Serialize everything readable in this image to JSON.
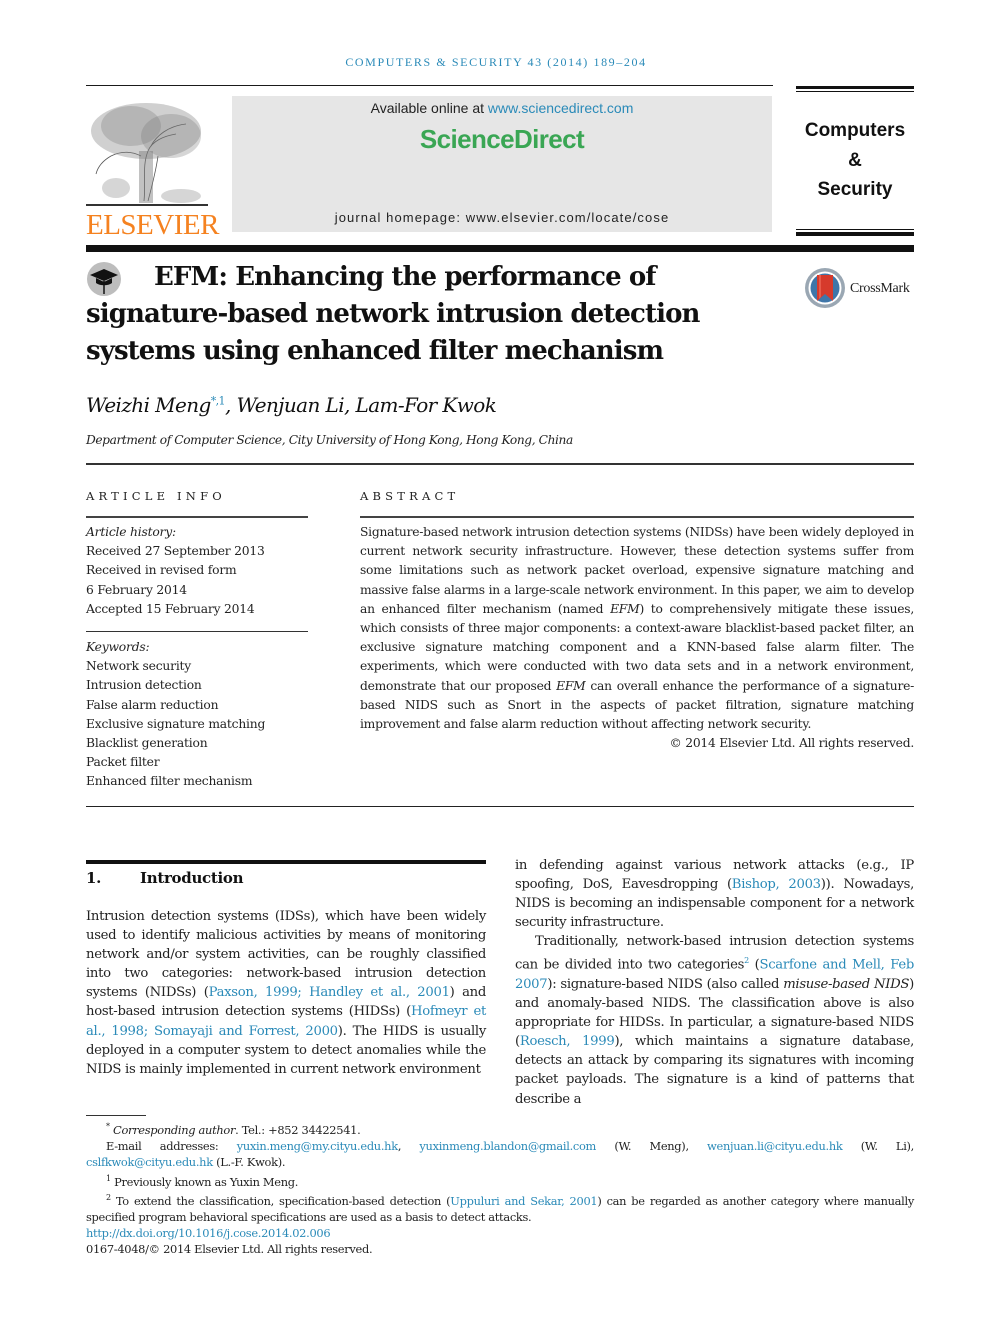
{
  "running_header": "COMPUTERS & SECURITY 43 (2014) 189–204",
  "masthead": {
    "publisher_logo_label": "ELSEVIER",
    "available_prefix": "Available online at ",
    "available_link": "www.sciencedirect.com",
    "platform_name": "ScienceDirect",
    "homepage_text": "journal homepage: www.elsevier.com/locate/cose",
    "journal_title_line1": "Computers",
    "journal_title_line2": "&",
    "journal_title_line3": "Security",
    "colors": {
      "elsevier_orange": "#f58220",
      "sciencedirect_green": "#3aa654",
      "link_blue": "#2a8ab8",
      "banner_gray": "#e6e6e6"
    }
  },
  "article": {
    "title": "EFM: Enhancing the performance of signature-based network intrusion detection systems using enhanced filter mechanism",
    "crossmark_label": "CrossMark",
    "authors": {
      "author1": "Weizhi Meng",
      "author1_marks": "*,1",
      "rest": ", Wenjuan Li, Lam-For Kwok"
    },
    "affiliation": "Department of Computer Science, City University of Hong Kong, Hong Kong, China"
  },
  "article_info": {
    "heading": "ARTICLE INFO",
    "history_label": "Article history:",
    "history": [
      "Received 27 September 2013",
      "Received in revised form",
      "6 February 2014",
      "Accepted 15 February 2014"
    ],
    "keywords_label": "Keywords:",
    "keywords": [
      "Network security",
      "Intrusion detection",
      "False alarm reduction",
      "Exclusive signature matching",
      "Blacklist generation",
      "Packet filter",
      "Enhanced filter mechanism"
    ]
  },
  "abstract": {
    "heading": "ABSTRACT",
    "p1": "Signature-based network intrusion detection systems (NIDSs) have been widely deployed in current network security infrastructure. However, these detection systems suffer from some limitations such as network packet overload, expensive signature matching and massive false alarms in a large-scale network environment. In this paper, we aim to develop an enhanced filter mechanism (named ",
    "efm1": "EFM",
    "p2": ") to comprehensively mitigate these issues, which consists of three major components: a context-aware blacklist-based packet filter, an exclusive signature matching component and a KNN-based false alarm filter. The experiments, which were conducted with two data sets and in a network environment, demonstrate that our proposed ",
    "efm2": "EFM",
    "p3": " can overall enhance the performance of a signature-based NIDS such as Snort in the aspects of packet filtration, signature matching improvement and false alarm reduction without affecting network security.",
    "copyright": "© 2014 Elsevier Ltd. All rights reserved."
  },
  "introduction": {
    "number": "1.",
    "title": "Introduction",
    "left": {
      "t1": "Intrusion detection systems (IDSs), which have been widely used to identify malicious activities by means of monitoring network and/or system activities, can be roughly classified into two categories: network-based intrusion detection systems (NIDSs) (",
      "c1": "Paxson, 1999; Handley et al., 2001",
      "t2": ") and host-based intrusion detection systems (HIDSs) (",
      "c2": "Hofmeyr et al., 1998; Somayaji and Forrest, 2000",
      "t3": "). The HIDS is usually deployed in a computer system to detect anomalies while the NIDS is mainly implemented in current network environment"
    },
    "right": {
      "t1": "in defending against various network attacks (e.g., IP spoofing, DoS, Eavesdropping (",
      "c1": "Bishop, 2003",
      "t2": ")). Nowadays, NIDS is becoming an indispensable component for a network security infrastructure.",
      "p2_t1": "Traditionally, network-based intrusion detection systems can be divided into two categories",
      "p2_fn": "2",
      "p2_t2": " (",
      "p2_c1": "Scarfone and Mell, Feb 2007",
      "p2_t3": "): signature-based NIDS (also called ",
      "p2_em": "misuse-based NIDS",
      "p2_t4": ") and anomaly-based NIDS. The classification above is also appropriate for HIDSs. In particular, a signature-based NIDS (",
      "p2_c2": "Roesch, 1999",
      "p2_t5": "), which maintains a signature database, detects an attack by comparing its signatures with incoming packet payloads. The signature is a kind of patterns that describe a"
    }
  },
  "footnotes": {
    "corr_mark": "*",
    "corr_label": "Corresponding author",
    "corr_tel": ". Tel.: +852 34422541.",
    "email_label": "E-mail addresses: ",
    "email1": "yuxin.meng@my.cityu.edu.hk",
    "sep1": ", ",
    "email2": "yuxinmeng.blandon@gmail.com",
    "who1": " (W. Meng), ",
    "email3": "wenjuan.li@cityu.edu.hk",
    "who2": " (W. Li), ",
    "email4": "cslfkwok@cityu.edu.hk",
    "who3": " (L.-F. Kwok).",
    "fn1_mark": "1",
    "fn1_text": " Previously known as Yuxin Meng.",
    "fn2_mark": "2",
    "fn2_t1": " To extend the classification, specification-based detection (",
    "fn2_cite": "Uppuluri and Sekar, 2001",
    "fn2_t2": ") can be regarded as another category where manually specified program behavioral specifications are used as a basis to detect attacks.",
    "doi": "http://dx.doi.org/10.1016/j.cose.2014.02.006",
    "issn_copyright": "0167-4048/© 2014 Elsevier Ltd. All rights reserved."
  }
}
